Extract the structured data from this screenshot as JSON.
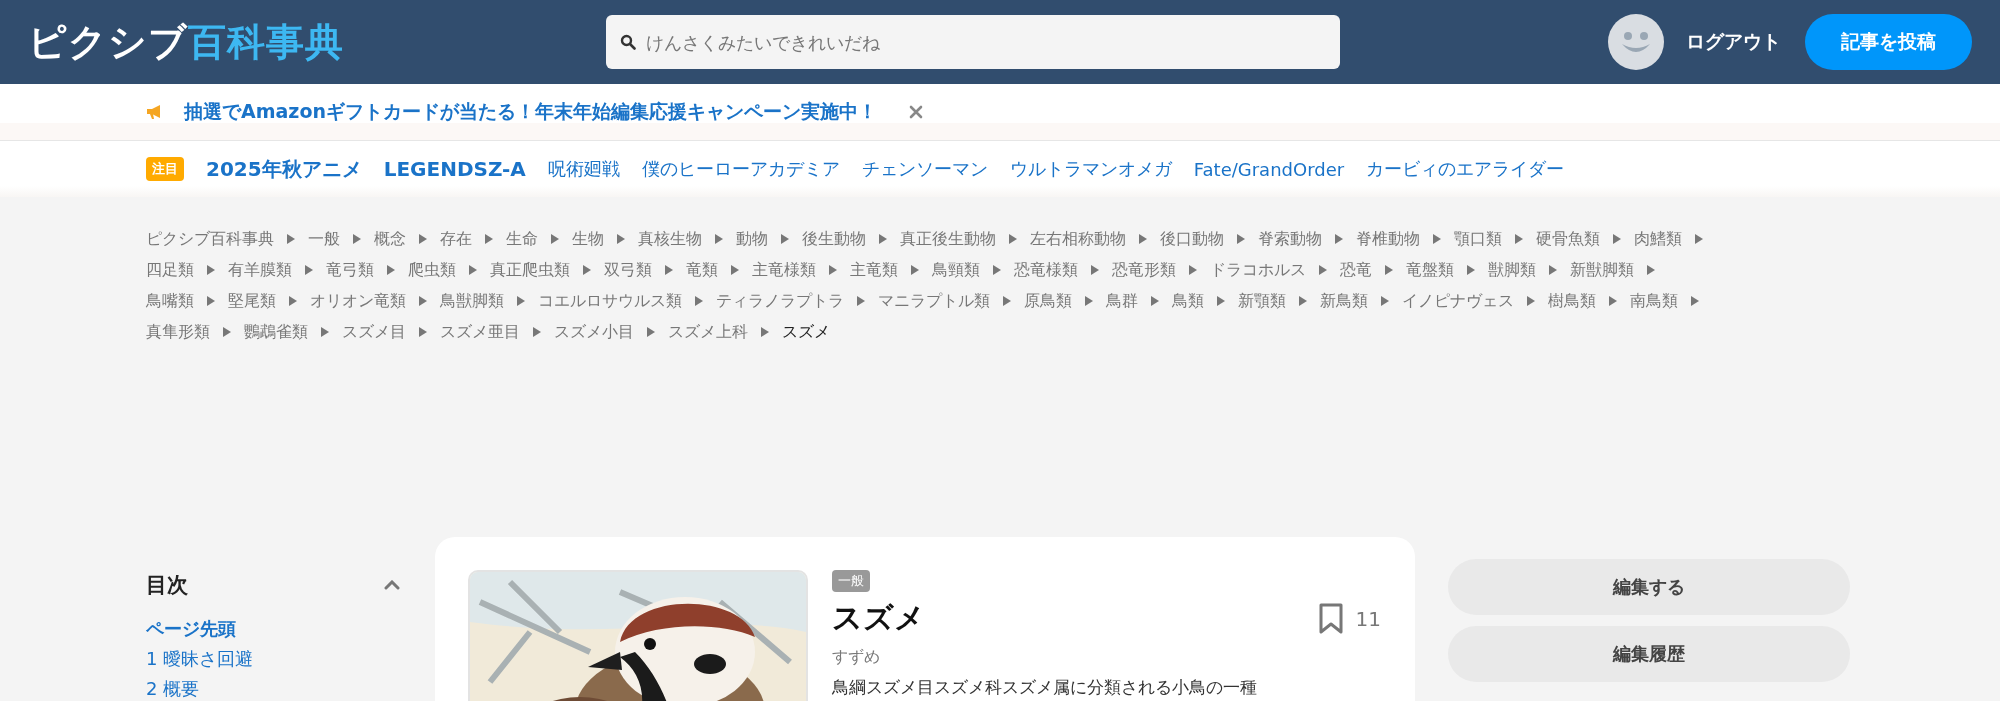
{
  "header": {
    "logo": {
      "kana": "ピクシブ",
      "kanji": "百科事典"
    },
    "search": {
      "placeholder": "けんさくみたいできれいだね"
    },
    "logout": "ログアウト",
    "post_button": "記事を投稿"
  },
  "notice": {
    "text": "抽選でAmazonギフトカードが当たる！年末年始編集応援キャンペーン実施中！"
  },
  "trending": {
    "badge": "注目",
    "items": [
      {
        "label": "2025年秋アニメ",
        "featured": true
      },
      {
        "label": "LEGENDSZ-A",
        "featured": true
      },
      {
        "label": "呪術廻戦",
        "featured": false
      },
      {
        "label": "僕のヒーローアカデミア",
        "featured": false
      },
      {
        "label": "チェンソーマン",
        "featured": false
      },
      {
        "label": "ウルトラマンオメガ",
        "featured": false
      },
      {
        "label": "Fate/GrandOrder",
        "featured": false
      },
      {
        "label": "カービィのエアライダー",
        "featured": false
      }
    ]
  },
  "breadcrumb": [
    {
      "label": "ピクシブ百科事典",
      "current": false
    },
    {
      "label": "一般",
      "current": false
    },
    {
      "label": "概念",
      "current": false
    },
    {
      "label": "存在",
      "current": false
    },
    {
      "label": "生命",
      "current": false
    },
    {
      "label": "生物",
      "current": false
    },
    {
      "label": "真核生物",
      "current": false
    },
    {
      "label": "動物",
      "current": false
    },
    {
      "label": "後生動物",
      "current": false
    },
    {
      "label": "真正後生動物",
      "current": false
    },
    {
      "label": "左右相称動物",
      "current": false
    },
    {
      "label": "後口動物",
      "current": false
    },
    {
      "label": "脊索動物",
      "current": false
    },
    {
      "label": "脊椎動物",
      "current": false
    },
    {
      "label": "顎口類",
      "current": false
    },
    {
      "label": "硬骨魚類",
      "current": false
    },
    {
      "label": "肉鰭類",
      "current": false
    },
    {
      "label": "四足類",
      "current": false
    },
    {
      "label": "有羊膜類",
      "current": false
    },
    {
      "label": "竜弓類",
      "current": false
    },
    {
      "label": "爬虫類",
      "current": false
    },
    {
      "label": "真正爬虫類",
      "current": false
    },
    {
      "label": "双弓類",
      "current": false
    },
    {
      "label": "竜類",
      "current": false
    },
    {
      "label": "主竜様類",
      "current": false
    },
    {
      "label": "主竜類",
      "current": false
    },
    {
      "label": "鳥頸類",
      "current": false
    },
    {
      "label": "恐竜様類",
      "current": false
    },
    {
      "label": "恐竜形類",
      "current": false
    },
    {
      "label": "ドラコホルス",
      "current": false
    },
    {
      "label": "恐竜",
      "current": false
    },
    {
      "label": "竜盤類",
      "current": false
    },
    {
      "label": "獣脚類",
      "current": false
    },
    {
      "label": "新獣脚類",
      "current": false
    },
    {
      "label": "鳥嘴類",
      "current": false
    },
    {
      "label": "堅尾類",
      "current": false
    },
    {
      "label": "オリオン竜類",
      "current": false
    },
    {
      "label": "鳥獣脚類",
      "current": false
    },
    {
      "label": "コエルロサウルス類",
      "current": false
    },
    {
      "label": "ティラノラプトラ",
      "current": false
    },
    {
      "label": "マニラプトル類",
      "current": false
    },
    {
      "label": "原鳥類",
      "current": false
    },
    {
      "label": "鳥群",
      "current": false
    },
    {
      "label": "鳥類",
      "current": false
    },
    {
      "label": "新顎類",
      "current": false
    },
    {
      "label": "新鳥類",
      "current": false
    },
    {
      "label": "イノピナヴェス",
      "current": false
    },
    {
      "label": "樹鳥類",
      "current": false
    },
    {
      "label": "南鳥類",
      "current": false
    },
    {
      "label": "真隼形類",
      "current": false
    },
    {
      "label": "鸚鵡雀類",
      "current": false
    },
    {
      "label": "スズメ目",
      "current": false
    },
    {
      "label": "スズメ亜目",
      "current": false
    },
    {
      "label": "スズメ小目",
      "current": false
    },
    {
      "label": "スズメ上科",
      "current": false
    },
    {
      "label": "スズメ",
      "current": true
    }
  ],
  "toc": {
    "title": "目次",
    "items": [
      {
        "label": "ページ先頭",
        "selected": true
      },
      {
        "label": "1 曖昧さ回避",
        "selected": false
      },
      {
        "label": "2 概要",
        "selected": false
      }
    ]
  },
  "article": {
    "category": "一般",
    "title": "スズメ",
    "reading": "すずめ",
    "bookmark_count": "11",
    "description": "鳥綱スズメ目スズメ科スズメ属に分類される小鳥の一種"
  },
  "actions": [
    "編集する",
    "編集履歴"
  ]
}
